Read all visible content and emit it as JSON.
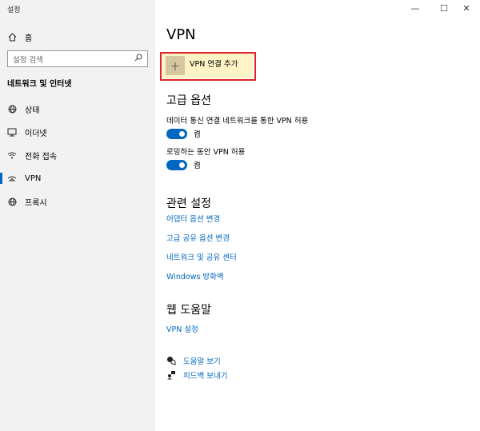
{
  "app": {
    "title": "설정"
  },
  "window_controls": {
    "minimize": "—",
    "maximize": "☐",
    "close": "✕"
  },
  "sidebar": {
    "home_label": "홈",
    "search": {
      "placeholder": "설정 검색"
    },
    "section_title": "네트워크 및 인터넷",
    "items": [
      {
        "label": "상태",
        "icon": "globe-status-icon"
      },
      {
        "label": "이더넷",
        "icon": "ethernet-icon"
      },
      {
        "label": "전화 접속",
        "icon": "dialup-icon"
      },
      {
        "label": "VPN",
        "icon": "vpn-icon",
        "selected": true
      },
      {
        "label": "프록시",
        "icon": "globe-icon"
      }
    ]
  },
  "main": {
    "title": "VPN",
    "add_vpn_label": "VPN 연결 추가",
    "advanced": {
      "heading": "고급 옵션",
      "option1_label": "데이터 통신 연결 네트워크를 통한 VPN 허용",
      "option1_state": "켬",
      "option2_label": "로밍하는 동안 VPN 허용",
      "option2_state": "켬"
    },
    "related": {
      "heading": "관련 설정",
      "links": [
        "어댑터 옵션 변경",
        "고급 공유 옵션 변경",
        "네트워크 및 공유 센터",
        "Windows 방화벽"
      ]
    },
    "web_help": {
      "heading": "웹 도움말",
      "link": "VPN 설정"
    },
    "footer": {
      "help_label": "도움말 보기",
      "feedback_label": "피드백 보내기"
    }
  },
  "colors": {
    "accent": "#0067c0",
    "highlight_border": "#e0242a",
    "add_bg": "#fdf3c5",
    "sidebar_bg": "#f2f2f2"
  }
}
